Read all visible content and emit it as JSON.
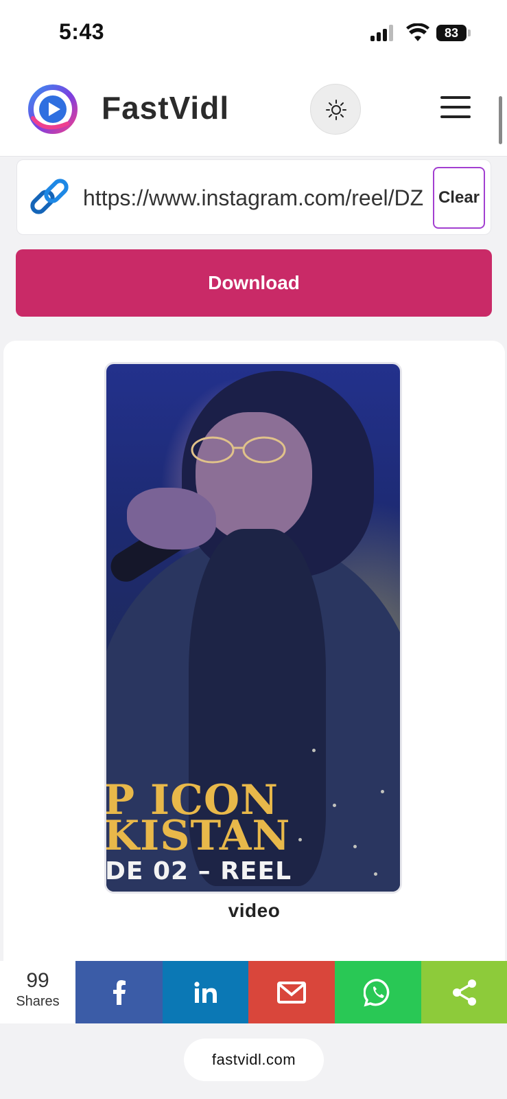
{
  "status_bar": {
    "time": "5:43",
    "battery": "83"
  },
  "header": {
    "brand": "FastVidl",
    "logo_icon": "play-logo-icon",
    "theme_icon": "sun-icon",
    "menu_icon": "hamburger-menu-icon"
  },
  "url_form": {
    "value": "https://www.instagram.com/reel/DZ",
    "link_icon": "link-icon",
    "clear_label": "Clear",
    "download_label": "Download"
  },
  "result": {
    "thumbnail_text": [
      "P ICON",
      "KISTAN",
      "DE 02 –  REEL"
    ],
    "media_type_label": "video"
  },
  "share_bar": {
    "count": "99",
    "count_label": "Shares",
    "buttons": [
      {
        "icon": "facebook-icon",
        "color": "#3b5ca7"
      },
      {
        "icon": "linkedin-icon",
        "color": "#0b78b5"
      },
      {
        "icon": "email-icon",
        "color": "#d9463b"
      },
      {
        "icon": "whatsapp-icon",
        "color": "#29c855"
      },
      {
        "icon": "share-icon",
        "color": "#8dcb3a"
      }
    ]
  },
  "browser": {
    "domain": "fastvidl.com"
  },
  "colors": {
    "accent": "#c92a67",
    "clear_border": "#a23fd0"
  }
}
